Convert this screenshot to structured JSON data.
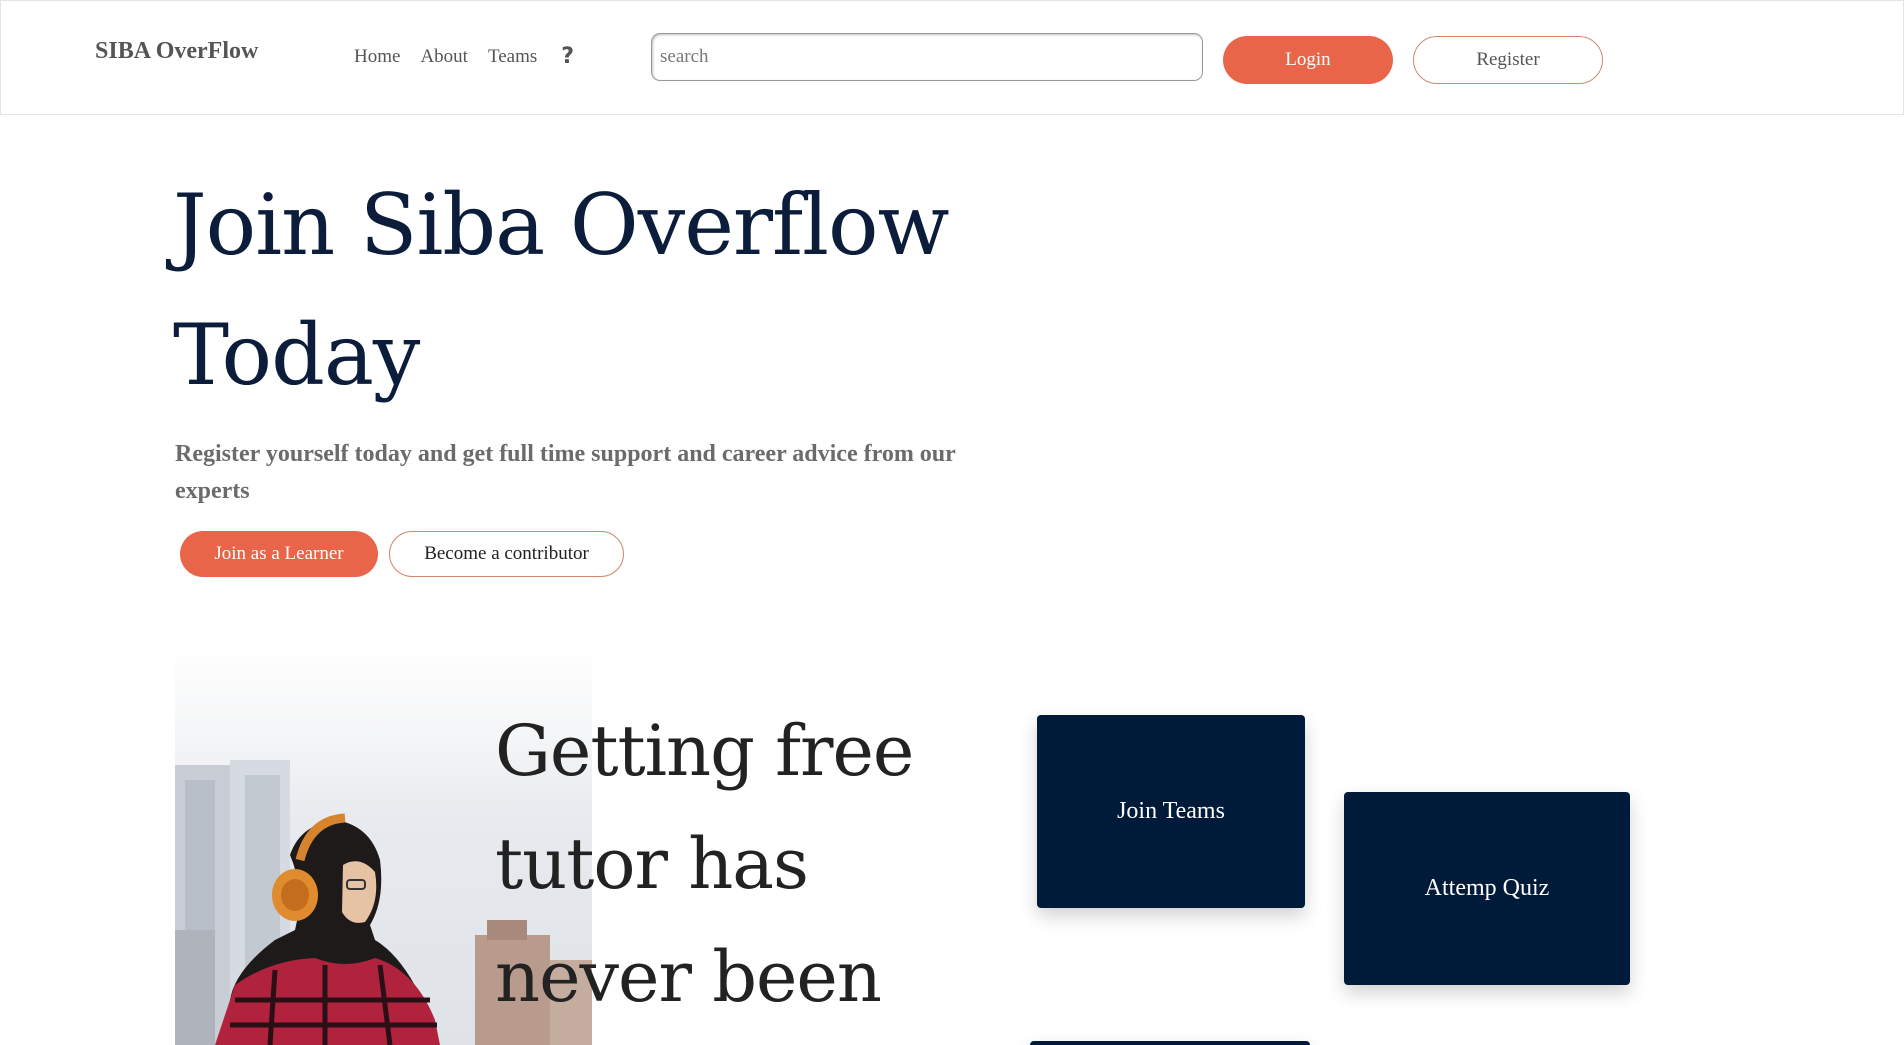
{
  "header": {
    "brand": "SIBA OverFlow",
    "nav": [
      {
        "label": "Home"
      },
      {
        "label": "About"
      },
      {
        "label": "Teams"
      }
    ],
    "help_icon": "question-mark-icon",
    "search": {
      "placeholder": "search",
      "value": ""
    },
    "login_label": "Login",
    "register_label": "Register"
  },
  "hero": {
    "title": "Join Siba Overflow Today",
    "subtitle": "Register yourself today and get full time support and career advice from our experts",
    "learner_button": "Join as a Learner",
    "contributor_button": "Become a contributor"
  },
  "feature": {
    "title": "Getting free tutor has never been"
  },
  "cards": {
    "join_teams": "Join Teams",
    "quiz": "Attemp Quiz"
  },
  "colors": {
    "accent": "#e8654a",
    "navy": "#001a3a",
    "heading": "#0b1d3a"
  }
}
